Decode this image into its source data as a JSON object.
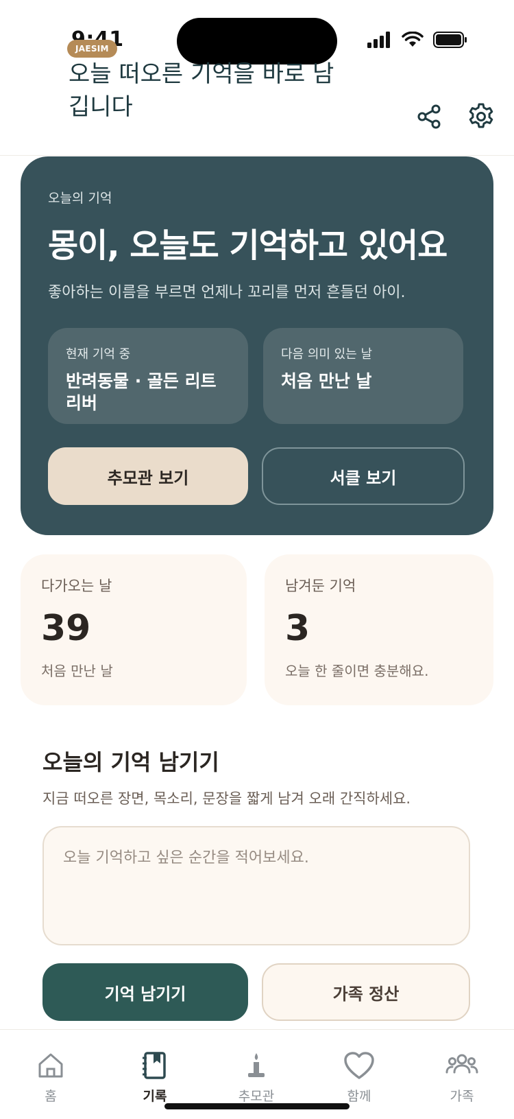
{
  "status_bar": {
    "time": "9:41"
  },
  "header": {
    "brand": "JAESIM",
    "title": "오늘 떠오른 기억을 바로 남깁니다"
  },
  "hero": {
    "eyebrow": "오늘의 기억",
    "title": "몽이, 오늘도 기억하고 있어요",
    "description": "좋아하는 이름을 부르면 언제나 꼬리를 먼저 흔들던 아이.",
    "tiles": [
      {
        "label": "현재 기억 중",
        "value": "반려동물 · 골든 리트리버"
      },
      {
        "label": "다음 의미 있는 날",
        "value": "처음 만난 날"
      }
    ],
    "primary_button": "추모관 보기",
    "secondary_button": "서클 보기"
  },
  "stats": [
    {
      "label": "다가오는 날",
      "value": "39",
      "sub": "처음 만난 날"
    },
    {
      "label": "남겨둔 기억",
      "value": "3",
      "sub": "오늘 한 줄이면 충분해요."
    }
  ],
  "today_memory": {
    "title": "오늘의 기억 남기기",
    "description": "지금 떠오른 장면, 목소리, 문장을 짧게 남겨 오래 간직하세요.",
    "placeholder": "오늘 기억하고 싶은 순간을 적어보세요.",
    "save_button": "기억 남기기",
    "family_button": "가족 정산"
  },
  "tabs": [
    {
      "label": "홈",
      "icon": "home-icon",
      "active": false
    },
    {
      "label": "기록",
      "icon": "notebook-icon",
      "active": true
    },
    {
      "label": "추모관",
      "icon": "candle-icon",
      "active": false
    },
    {
      "label": "함께",
      "icon": "heart-icon",
      "active": false
    },
    {
      "label": "가족",
      "icon": "people-icon",
      "active": false
    }
  ],
  "colors": {
    "hero_bg": "#37525a",
    "accent_green": "#2e5a56",
    "brand_gold": "#b58b57",
    "cream": "#fdf7f1"
  }
}
